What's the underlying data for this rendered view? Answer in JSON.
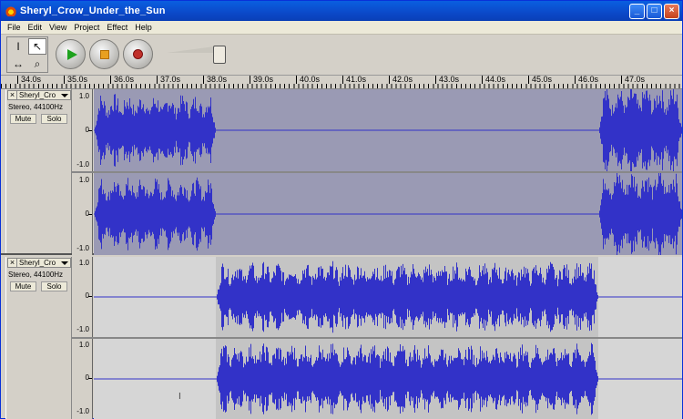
{
  "window": {
    "title": "Sheryl_Crow_Under_the_Sun"
  },
  "menu": [
    "File",
    "Edit",
    "View",
    "Project",
    "Effect",
    "Help"
  ],
  "toolbar": {
    "tools": [
      "selection-tool",
      "envelope-tool",
      "timeshift-tool",
      "zoom-tool"
    ],
    "play_color": "#1ea21e",
    "stop_color": "#e8a020",
    "record_color": "#c0302b"
  },
  "ruler": {
    "labels": [
      "34.0s",
      "35.0s",
      "36.0s",
      "37.0s",
      "38.0s",
      "39.0s",
      "40.0s",
      "41.0s",
      "42.0s",
      "43.0s",
      "44.0s",
      "45.0s",
      "46.0s",
      "47.0s"
    ]
  },
  "tracks": [
    {
      "name": "Sheryl_Cro",
      "rate": "Stereo, 44100Hz",
      "mute": "Mute",
      "solo": "Solo",
      "scale": {
        "top": "1.0",
        "mid": "0",
        "bottom": "-1.0"
      },
      "colors": {
        "bg_selected": "#9a9ab4",
        "wave": "#3232c8"
      }
    },
    {
      "name": "Sheryl_Cro",
      "rate": "Stereo, 44100Hz",
      "mute": "Mute",
      "solo": "Solo",
      "scale": {
        "top": "1.0",
        "mid": "0",
        "bottom": "-1.0"
      },
      "colors": {
        "bg_unselected": "#d6d6d6",
        "clip_bg": "#c4c4c4",
        "wave": "#3232c8"
      }
    }
  ]
}
